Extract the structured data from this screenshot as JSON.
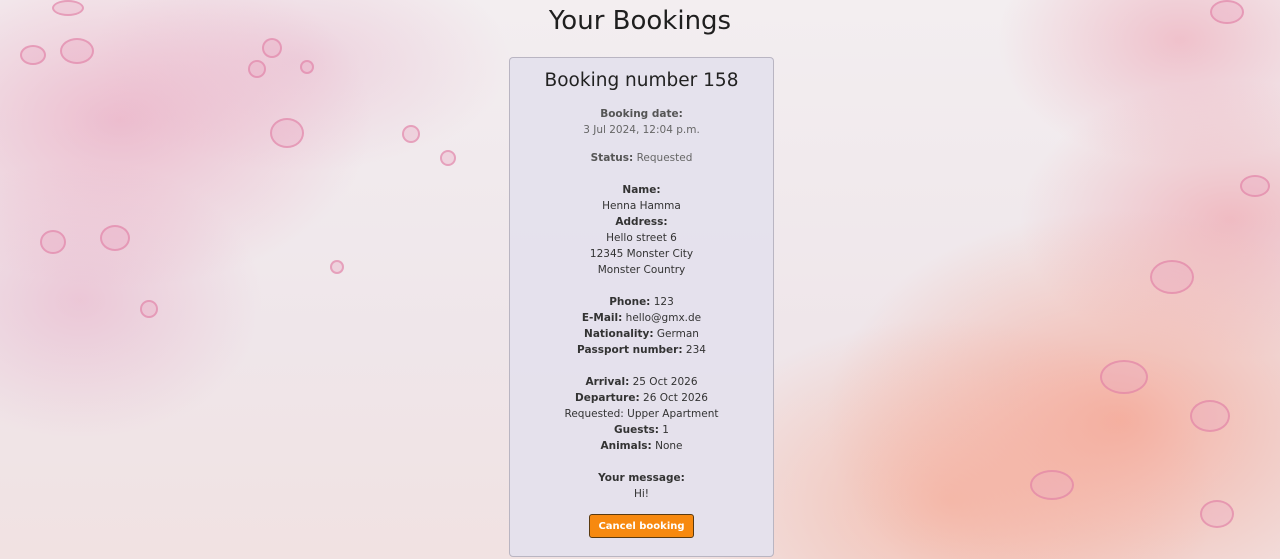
{
  "page": {
    "title": "Your Bookings"
  },
  "booking": {
    "number_label": "Booking number",
    "number": "158",
    "booking_date_label": "Booking date:",
    "booking_date": "3 Jul 2024, 12:04 p.m.",
    "status_label": "Status:",
    "status": "Requested",
    "name_label": "Name:",
    "name": "Henna Hamma",
    "address_label": "Address:",
    "address_lines": [
      "Hello street 6",
      "12345 Monster City",
      "Monster Country"
    ],
    "phone_label": "Phone:",
    "phone": "123",
    "email_label": "E-Mail:",
    "email": "hello@gmx.de",
    "nationality_label": "Nationality:",
    "nationality": "German",
    "passport_label": "Passport number:",
    "passport": "234",
    "arrival_label": "Arrival:",
    "arrival": "25 Oct 2026",
    "departure_label": "Departure:",
    "departure": "26 Oct 2026",
    "requested_label": "Requested:",
    "requested": "Upper Apartment",
    "guests_label": "Guests:",
    "guests": "1",
    "animals_label": "Animals:",
    "animals": "None",
    "message_label": "Your message:",
    "message": "Hi!",
    "cancel_label": "Cancel booking"
  },
  "colors": {
    "accent_button": "#f7890f",
    "card_background": "#e4e1ec"
  }
}
